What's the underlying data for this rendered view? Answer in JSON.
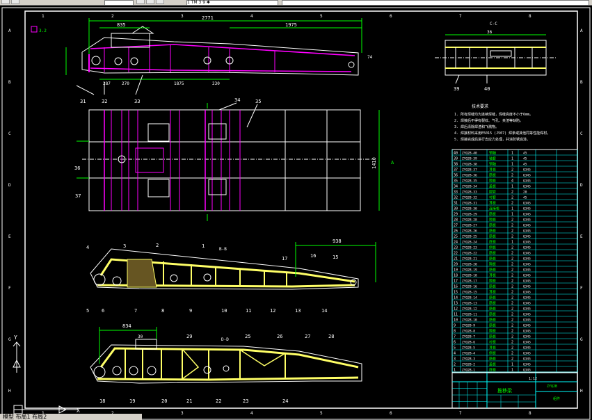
{
  "toolbar": {
    "dropdown_text": "1 TM  3 9 ✱",
    "layer_label": ""
  },
  "drawing": {
    "top_view": {
      "overall_length": "2771",
      "dim_835": "835",
      "dim_1975": "1975",
      "dim_287": "287",
      "dim_270": "270",
      "dim_1875": "1875",
      "dim_230": "230",
      "dim_74": "74",
      "callouts": [
        "31",
        "32",
        "33"
      ],
      "roughness": "3.2"
    },
    "plan_view": {
      "width_dim": "1410",
      "callouts": [
        "34",
        "35",
        "36",
        "37"
      ],
      "section_label": "A"
    },
    "section_b": {
      "label": "B-B",
      "dim_938": "938",
      "callouts_top": [
        "4",
        "3",
        "2",
        "1",
        "17",
        "16",
        "15"
      ],
      "callouts_bottom": [
        "5",
        "6",
        "7",
        "8",
        "9",
        "10",
        "11",
        "12",
        "13",
        "14"
      ]
    },
    "section_d": {
      "label": "D-D",
      "dim_834": "834",
      "dim_30": "30",
      "callouts_top": [
        "29",
        "25",
        "26",
        "27",
        "28"
      ],
      "callouts_bottom": [
        "18",
        "19",
        "20",
        "21",
        "22",
        "23",
        "24"
      ]
    },
    "section_c": {
      "label": "C-C",
      "dim_36": "36",
      "callouts": [
        "39",
        "40"
      ]
    },
    "tech_requirements": {
      "title": "技术要求",
      "lines": [
        "1. 所有焊缝均为连续焊缝，焊缝高度不小于6mm。",
        "2. 焊接后不得有裂纹、气孔、夹渣等缺陷。",
        "3. 焊后清除焊渣和飞溅物。",
        "4. 焊接材料采用E5015 (J507) 焊条或其他同等性能焊材。",
        "5. 焊接完成后进行去应力处理，并涂防锈底漆。"
      ]
    },
    "parts_list": {
      "row_prefix": "ZYQ2B-",
      "rows": [
        [
          "40",
          "ZYQ2B-40",
          "销轴",
          "1",
          "45"
        ],
        [
          "39",
          "ZYQ2B-39",
          "轴套",
          "1",
          "45"
        ],
        [
          "38",
          "ZYQ2B-38",
          "销轴",
          "1",
          "45"
        ],
        [
          "37",
          "ZYQ2B-37",
          "耳板",
          "2",
          "Q345"
        ],
        [
          "36",
          "ZYQ2B-36",
          "筋板",
          "2",
          "Q345"
        ],
        [
          "35",
          "ZYQ2B-35",
          "隔板",
          "4",
          "Q345"
        ],
        [
          "34",
          "ZYQ2B-34",
          "盖板",
          "1",
          "Q345"
        ],
        [
          "33",
          "ZYQ2B-33",
          "圆管",
          "2",
          "20"
        ],
        [
          "32",
          "ZYQ2B-32",
          "衬套",
          "2",
          "45"
        ],
        [
          "31",
          "ZYQ2B-31",
          "耳板",
          "2",
          "Q345"
        ],
        [
          "30",
          "ZYQ2B-30",
          "连接板",
          "1",
          "Q345"
        ],
        [
          "29",
          "ZYQ2B-29",
          "筋板",
          "1",
          "Q345"
        ],
        [
          "28",
          "ZYQ2B-28",
          "隔板",
          "2",
          "Q345"
        ],
        [
          "27",
          "ZYQ2B-27",
          "筋板",
          "2",
          "Q345"
        ],
        [
          "26",
          "ZYQ2B-26",
          "筋板",
          "2",
          "Q345"
        ],
        [
          "25",
          "ZYQ2B-25",
          "筋板",
          "2",
          "Q345"
        ],
        [
          "24",
          "ZYQ2B-24",
          "底板",
          "1",
          "Q345"
        ],
        [
          "23",
          "ZYQ2B-23",
          "侧板",
          "2",
          "Q345"
        ],
        [
          "22",
          "ZYQ2B-22",
          "筋板",
          "2",
          "Q345"
        ],
        [
          "21",
          "ZYQ2B-21",
          "筋板",
          "2",
          "Q345"
        ],
        [
          "20",
          "ZYQ2B-20",
          "隔板",
          "2",
          "Q345"
        ],
        [
          "19",
          "ZYQ2B-19",
          "筋板",
          "2",
          "Q345"
        ],
        [
          "18",
          "ZYQ2B-18",
          "耳板",
          "2",
          "Q345"
        ],
        [
          "17",
          "ZYQ2B-17",
          "隔板",
          "2",
          "Q345"
        ],
        [
          "16",
          "ZYQ2B-16",
          "筋板",
          "2",
          "Q345"
        ],
        [
          "15",
          "ZYQ2B-15",
          "耳板",
          "2",
          "Q345"
        ],
        [
          "14",
          "ZYQ2B-14",
          "筋板",
          "2",
          "Q345"
        ],
        [
          "13",
          "ZYQ2B-13",
          "筋板",
          "2",
          "Q345"
        ],
        [
          "12",
          "ZYQ2B-12",
          "筋板",
          "2",
          "Q345"
        ],
        [
          "11",
          "ZYQ2B-11",
          "筋板",
          "2",
          "Q345"
        ],
        [
          "10",
          "ZYQ2B-10",
          "筋板",
          "2",
          "Q345"
        ],
        [
          "9",
          "ZYQ2B-9",
          "筋板",
          "2",
          "Q345"
        ],
        [
          "8",
          "ZYQ2B-8",
          "隔板",
          "2",
          "Q345"
        ],
        [
          "7",
          "ZYQ2B-7",
          "筋板",
          "2",
          "Q345"
        ],
        [
          "6",
          "ZYQ2B-6",
          "衬板",
          "2",
          "Q345"
        ],
        [
          "5",
          "ZYQ2B-5",
          "耳板",
          "2",
          "Q345"
        ],
        [
          "4",
          "ZYQ2B-4",
          "侧板",
          "2",
          "Q345"
        ],
        [
          "3",
          "ZYQ2B-3",
          "筋板",
          "2",
          "Q345"
        ],
        [
          "2",
          "ZYQ2B-2",
          "盖板",
          "1",
          "Q345"
        ],
        [
          "1",
          "ZYQ2B-1",
          "底板",
          "1",
          "Q345"
        ]
      ]
    },
    "title_block": {
      "part_name": "推移梁",
      "drawing_no": "ZYQ2B",
      "material": "组件",
      "scale": "1:12",
      "sheet": "1"
    },
    "border_cols": [
      "1",
      "2",
      "3",
      "4",
      "5",
      "6",
      "7",
      "8"
    ],
    "border_rows": [
      "A",
      "B",
      "C",
      "D",
      "E",
      "F",
      "G",
      "H"
    ]
  },
  "status": {
    "command_text": "模型 布局1 布局2"
  },
  "colors": {
    "background": "#000000",
    "outline": "#ffffff",
    "magenta": "#ff00ff",
    "cyan": "#00ffff",
    "green": "#00ff00",
    "yellow": "#ffff00",
    "hatch": "#ffff66"
  }
}
